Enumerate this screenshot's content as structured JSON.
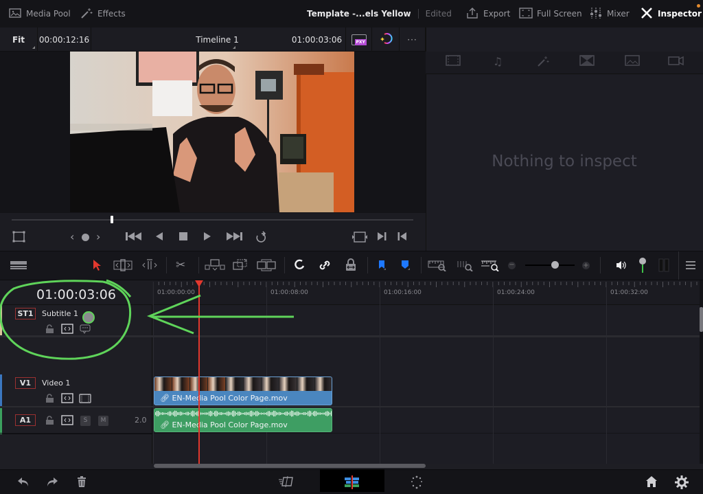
{
  "topbar": {
    "media_pool": "Media Pool",
    "effects": "Effects",
    "project_title": "Template -...els Yellow",
    "status": "Edited",
    "export": "Export",
    "full_screen": "Full Screen",
    "mixer": "Mixer",
    "inspector": "Inspector"
  },
  "viewer": {
    "zoom": "Fit",
    "duration": "00:00:12:16",
    "timeline_name": "Timeline 1",
    "timecode": "01:00:03:06",
    "proxy_badge": "PXY",
    "scrub_position": 0.25,
    "more": "···"
  },
  "inspector": {
    "tabs": [
      "video-icon",
      "audio-icon",
      "effects-icon",
      "transition-icon",
      "image-icon",
      "file-icon"
    ],
    "empty_message": "Nothing to inspect"
  },
  "timeline": {
    "timecode": "01:00:03:06",
    "ruler_labels": [
      "01:00:00:00",
      "01:00:08:00",
      "01:00:16:00",
      "01:00:24:00",
      "01:00:32:00"
    ],
    "tracks": [
      {
        "id": "ST1",
        "name": "Subtitle 1",
        "color": "#d9c39a"
      },
      {
        "id": "V1",
        "name": "Video 1",
        "color": "#3b77c0"
      },
      {
        "id": "A1",
        "name": "",
        "level": "2.0",
        "color": "#3ba05e",
        "solo": "S",
        "mute": "M"
      }
    ],
    "video_clip": "EN-Media Pool Color Page.mov",
    "audio_clip": "EN-Media Pool Color Page.mov",
    "zoom_level": 0.6
  },
  "colors": {
    "playhead": "#e2382e",
    "video_clip": "#4a86bf",
    "audio_clip": "#3e9e63",
    "annotation": "#5fd45a",
    "flag": "#1e78ff"
  }
}
